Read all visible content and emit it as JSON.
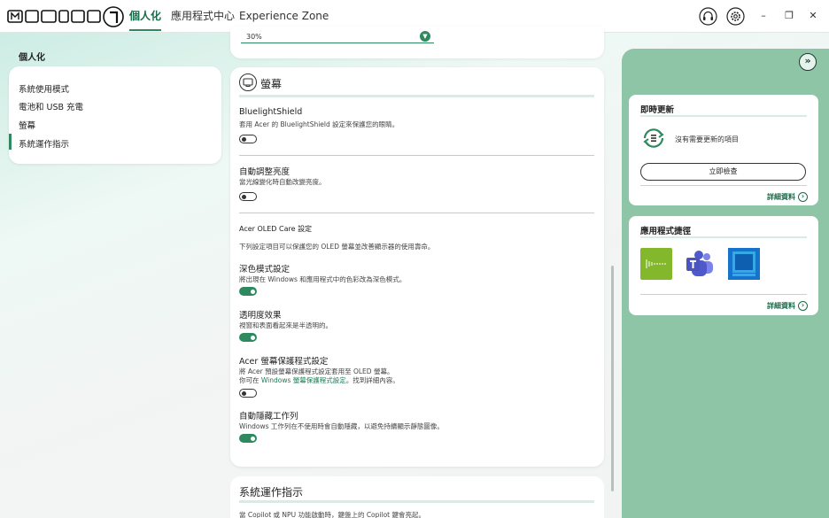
{
  "nav": {
    "tabs": [
      {
        "label": "個人化",
        "active": true
      },
      {
        "label": "應用程式中心",
        "active": false
      },
      {
        "label": "Experience Zone",
        "active": false
      }
    ],
    "support_icon": "headset-icon",
    "settings_icon": "gear-icon"
  },
  "window": {
    "minimize": "–",
    "restore": "❐",
    "close": "✕"
  },
  "sidebar": {
    "title": "個人化",
    "items": [
      {
        "label": "系統使用模式"
      },
      {
        "label": "電池和 USB 充電"
      },
      {
        "label": "螢幕"
      },
      {
        "label": "系統運作指示",
        "active": true
      }
    ]
  },
  "top_card": {
    "select_value": "30%"
  },
  "screen": {
    "title": "螢幕",
    "bluelight": {
      "title": "BluelightShield",
      "desc": "套用 Acer 的 BluelightShield 設定來保護您的眼睛。",
      "on": false
    },
    "auto_brightness": {
      "title": "自動調整亮度",
      "desc": "當光線變化時自動改變亮度。",
      "on": false
    },
    "oled": {
      "title": "Acer OLED Care 設定",
      "desc": "下列設定項目可以保護您的 OLED 螢幕並改善顯示器的使用壽命。"
    },
    "dark_mode": {
      "title": "深色模式設定",
      "desc": "將出現在 Windows 和應用程式中的色彩改為深色模式。",
      "on": true
    },
    "transparency": {
      "title": "透明度效果",
      "desc": "視窗和表面看起來是半透明的。",
      "on": true
    },
    "screensaver": {
      "title": "Acer 螢幕保護程式設定",
      "desc1": "將 Acer 預設螢幕保護程式設定套用至 OLED 螢幕。",
      "desc2_pre": "你可在 ",
      "desc2_link": "Windows 螢幕保護程式設定",
      "desc2_post": "。找到詳細內容。",
      "on": false
    },
    "autohide": {
      "title": "自動隱藏工作列",
      "desc": "Windows 工作列在不使用時會自動隱藏，以避免持續顯示靜態圖像。",
      "on": true
    }
  },
  "bottom_card": {
    "title": "系統運作指示",
    "desc": "當 Copilot 或 NPU 功能啟動時，鍵盤上的 Copilot 鍵會亮起。"
  },
  "right": {
    "updates": {
      "title": "即時更新",
      "status": "沒有需要更新的項目",
      "check_button": "立即檢查",
      "more": "詳細資料"
    },
    "shortcuts": {
      "title": "應用程式捷徑",
      "apps": [
        "acer-purifiedvoice-app-icon",
        "teams-app-icon",
        "acer-app-icon"
      ],
      "more": "詳細資料"
    }
  },
  "colors": {
    "accent": "#2e8a5e",
    "panel": "#8fc5a7"
  }
}
